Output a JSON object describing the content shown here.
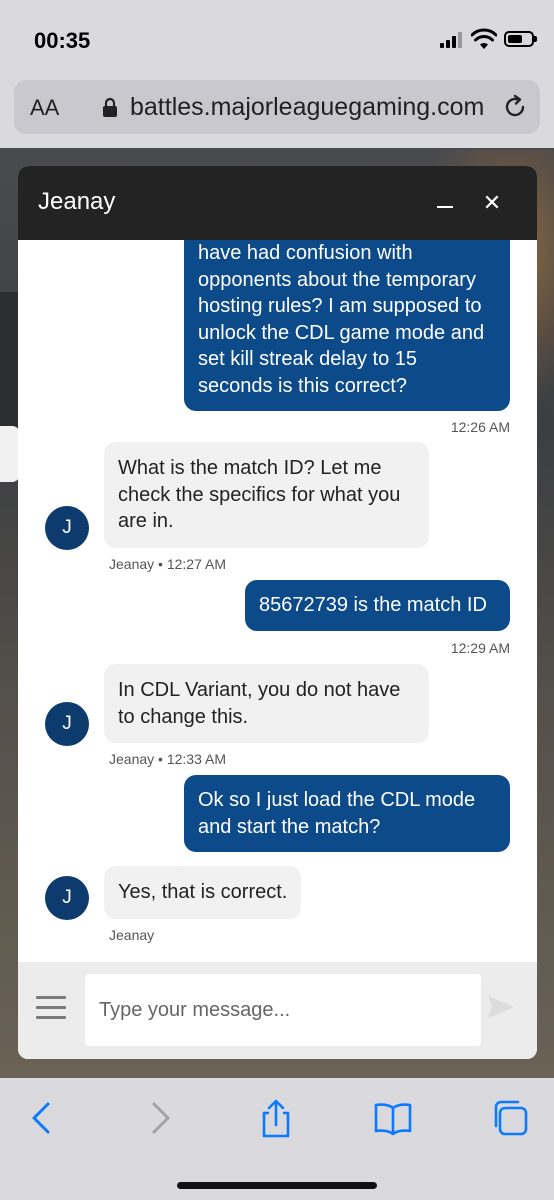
{
  "status_bar": {
    "time": "00:35"
  },
  "address_bar": {
    "text_size_label": "AA",
    "url": "battles.majorleaguegaming.com"
  },
  "chat": {
    "agent_name": "Jeanay",
    "avatar_initial": "J",
    "messages": [
      {
        "from": "user",
        "text": "have had confusion with opponents about the temporary hosting rules? I am supposed to unlock the CDL game mode and set kill streak delay to 15 seconds is this correct?",
        "meta": "12:26 AM"
      },
      {
        "from": "agent",
        "text": "What  is the match ID? Let me check the specifics for what you are in.",
        "meta": "Jeanay • 12:27 AM"
      },
      {
        "from": "user",
        "text": "85672739 is the match ID",
        "meta": "12:29 AM"
      },
      {
        "from": "agent",
        "text": "In CDL  Variant,  you  do not have to change this.",
        "meta": "Jeanay • 12:33 AM"
      },
      {
        "from": "user",
        "text": "Ok so I just load the CDL mode and start the match?",
        "meta": ""
      },
      {
        "from": "agent",
        "text": "Yes, that is correct.",
        "meta": "Jeanay"
      }
    ],
    "composer": {
      "placeholder": "Type your message..."
    }
  },
  "colors": {
    "user_bubble": "#0d4a8a",
    "agent_bubble": "#f1f1f1",
    "header": "#232323",
    "accent": "#0a7aff"
  },
  "icons": {
    "status": [
      "signal-icon",
      "wifi-icon",
      "battery-icon"
    ],
    "address": [
      "lock-icon",
      "reload-icon"
    ],
    "chat": [
      "minimize-icon",
      "close-icon",
      "menu-icon",
      "send-icon"
    ],
    "toolbar": [
      "back-icon",
      "forward-icon",
      "share-icon",
      "bookmarks-icon",
      "tabs-icon"
    ]
  }
}
